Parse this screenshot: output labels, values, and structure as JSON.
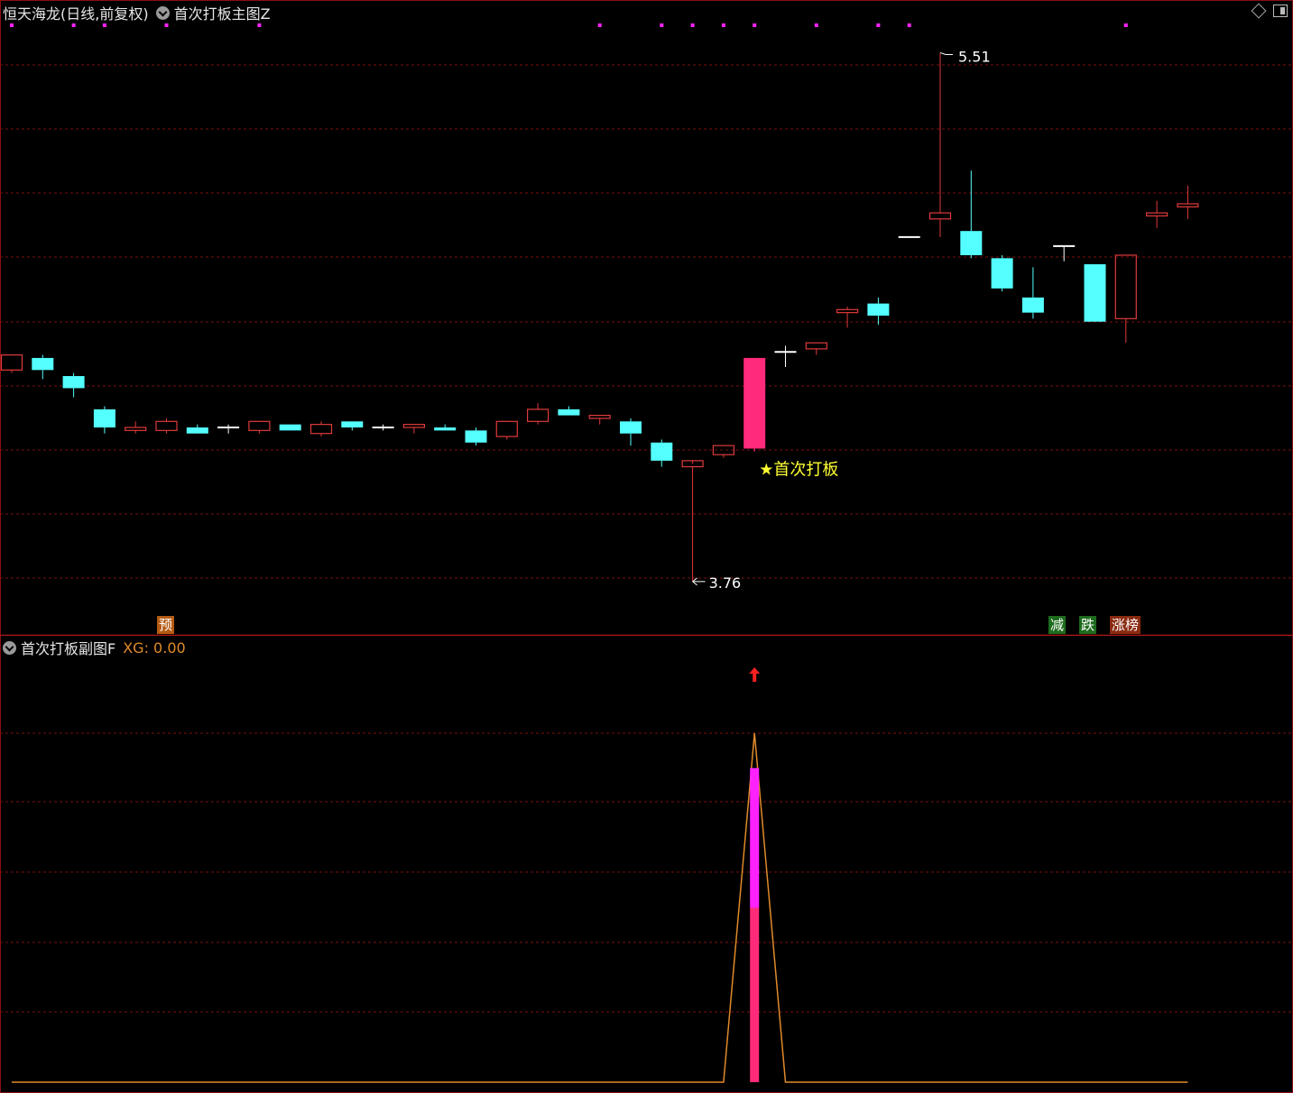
{
  "header": {
    "stock_title": "恒天海龙(日线,前复权)",
    "main_indicator": "首次打板主图Z"
  },
  "sub_panel": {
    "indicator": "首次打板副图F",
    "xg_label": "XG: 0.00"
  },
  "badges": {
    "yu": "预",
    "jian": "减",
    "die": "跌",
    "zhangbang": "涨榜"
  },
  "colors": {
    "up": "#e03a3a",
    "down": "#54ffff",
    "limit_up": "#ff2a7a",
    "grid": "#7a1010",
    "signal_dot": "#ff22ff",
    "line": "#e08a2a",
    "annotation": "#ffff33",
    "xg_bar_top": "#ff22ff",
    "xg_bar_bottom": "#ff2a7a"
  },
  "chart_data": [
    {
      "type": "candlestick",
      "title": "恒天海龙(日线,前复权)",
      "grid": true,
      "ylim": [
        3.7,
        5.58
      ],
      "annotations": {
        "high_label": "5.51",
        "low_label": "3.76",
        "signal_text": "★首次打板"
      },
      "candles": [
        {
          "o": 4.46,
          "h": 4.51,
          "l": 4.45,
          "c": 4.51
        },
        {
          "o": 4.5,
          "h": 4.51,
          "l": 4.43,
          "c": 4.46
        },
        {
          "o": 4.44,
          "h": 4.45,
          "l": 4.37,
          "c": 4.4
        },
        {
          "o": 4.33,
          "h": 4.34,
          "l": 4.25,
          "c": 4.27
        },
        {
          "o": 4.26,
          "h": 4.29,
          "l": 4.25,
          "c": 4.27
        },
        {
          "o": 4.26,
          "h": 4.3,
          "l": 4.25,
          "c": 4.29
        },
        {
          "o": 4.27,
          "h": 4.28,
          "l": 4.25,
          "c": 4.25
        },
        {
          "o": 4.27,
          "h": 4.28,
          "l": 4.25,
          "c": 4.27
        },
        {
          "o": 4.26,
          "h": 4.29,
          "l": 4.25,
          "c": 4.29
        },
        {
          "o": 4.28,
          "h": 4.28,
          "l": 4.26,
          "c": 4.26
        },
        {
          "o": 4.25,
          "h": 4.29,
          "l": 4.24,
          "c": 4.28
        },
        {
          "o": 4.29,
          "h": 4.29,
          "l": 4.26,
          "c": 4.27
        },
        {
          "o": 4.27,
          "h": 4.28,
          "l": 4.26,
          "c": 4.27
        },
        {
          "o": 4.27,
          "h": 4.28,
          "l": 4.25,
          "c": 4.28
        },
        {
          "o": 4.27,
          "h": 4.28,
          "l": 4.26,
          "c": 4.26
        },
        {
          "o": 4.26,
          "h": 4.27,
          "l": 4.21,
          "c": 4.22
        },
        {
          "o": 4.24,
          "h": 4.29,
          "l": 4.23,
          "c": 4.29
        },
        {
          "o": 4.29,
          "h": 4.35,
          "l": 4.28,
          "c": 4.33
        },
        {
          "o": 4.33,
          "h": 4.34,
          "l": 4.31,
          "c": 4.31
        },
        {
          "o": 4.3,
          "h": 4.31,
          "l": 4.28,
          "c": 4.31
        },
        {
          "o": 4.29,
          "h": 4.3,
          "l": 4.21,
          "c": 4.25
        },
        {
          "o": 4.22,
          "h": 4.23,
          "l": 4.14,
          "c": 4.16
        },
        {
          "o": 4.14,
          "h": 4.15,
          "l": 3.76,
          "c": 4.16
        },
        {
          "o": 4.18,
          "h": 4.21,
          "l": 4.17,
          "c": 4.21
        },
        {
          "o": 4.2,
          "h": 4.5,
          "l": 4.19,
          "c": 4.5
        },
        {
          "o": 4.52,
          "h": 4.54,
          "l": 4.47,
          "c": 4.52
        },
        {
          "o": 4.53,
          "h": 4.55,
          "l": 4.51,
          "c": 4.55
        },
        {
          "o": 4.65,
          "h": 4.67,
          "l": 4.6,
          "c": 4.66
        },
        {
          "o": 4.68,
          "h": 4.7,
          "l": 4.61,
          "c": 4.64
        },
        {
          "o": 4.9,
          "h": 4.9,
          "l": 4.9,
          "c": 4.9
        },
        {
          "o": 4.96,
          "h": 5.51,
          "l": 4.9,
          "c": 4.98
        },
        {
          "o": 4.92,
          "h": 5.12,
          "l": 4.83,
          "c": 4.84
        },
        {
          "o": 4.83,
          "h": 4.84,
          "l": 4.72,
          "c": 4.73
        },
        {
          "o": 4.7,
          "h": 4.8,
          "l": 4.63,
          "c": 4.65
        },
        {
          "o": 4.87,
          "h": 4.87,
          "l": 4.82,
          "c": 4.87
        },
        {
          "o": 4.81,
          "h": 4.81,
          "l": 4.62,
          "c": 4.62
        },
        {
          "o": 4.63,
          "h": 4.84,
          "l": 4.55,
          "c": 4.84
        },
        {
          "o": 4.97,
          "h": 5.02,
          "l": 4.93,
          "c": 4.98
        },
        {
          "o": 5.0,
          "h": 5.07,
          "l": 4.96,
          "c": 5.01
        }
      ],
      "limit_up_index": 24,
      "signal_dot_indices": [
        0,
        2,
        3,
        5,
        8,
        19,
        21,
        22,
        23,
        24,
        26,
        28,
        29,
        36
      ]
    },
    {
      "type": "line",
      "title": "首次打板副图F",
      "series": [
        {
          "name": "XG",
          "values": [
            0,
            0,
            0,
            0,
            0,
            0,
            0,
            0,
            0,
            0,
            0,
            0,
            0,
            0,
            0,
            0,
            0,
            0,
            0,
            0,
            0,
            0,
            0,
            0,
            1,
            0,
            0,
            0,
            0,
            0,
            0,
            0,
            0,
            0,
            0,
            0,
            0,
            0,
            0
          ]
        }
      ],
      "xg_bar": {
        "index": 24,
        "top": 0.9,
        "split": 0.5
      }
    }
  ]
}
